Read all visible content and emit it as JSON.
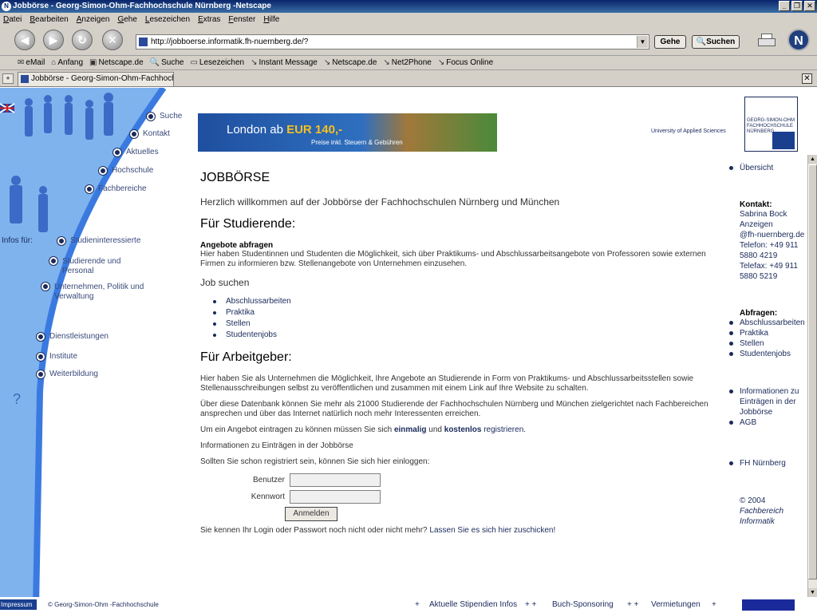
{
  "window": {
    "title": "Jobbörse - Georg-Simon-Ohm-Fachhochschule Nürnberg -Netscape",
    "minimize": "_",
    "maximize": "❐",
    "close": "✕"
  },
  "menu": [
    "Datei",
    "Bearbeiten",
    "Anzeigen",
    "Gehe",
    "Lesezeichen",
    "Extras",
    "Fenster",
    "Hilfe"
  ],
  "nav": {
    "url": "http://jobboerse.informatik.fh-nuernberg.de/?",
    "go_label": "Gehe",
    "search_label": "Suchen",
    "logo_letter": "N"
  },
  "personal_toolbar": {
    "items": [
      {
        "label": "eMail"
      },
      {
        "label": "Anfang"
      },
      {
        "label": "Netscape.de"
      },
      {
        "label": "Suche"
      },
      {
        "label": "Lesezeichen"
      },
      {
        "label": "Instant Message"
      },
      {
        "label": "Netscape.de"
      },
      {
        "label": "Net2Phone"
      },
      {
        "label": "Focus Online"
      }
    ]
  },
  "tab": {
    "title": "Jobbörse - Georg-Simon-Ohm-Fachhochsch..."
  },
  "leftnav": {
    "top_items": [
      "Suche",
      "Kontakt",
      "Aktuelles",
      "Hochschule",
      "Fachbereiche"
    ],
    "infos_label": "Infos für:",
    "info_items": [
      "Studieninteressierte",
      "Studierende und Personal",
      "Unternehmen, Politik und Verwaltung"
    ],
    "bottom_items": [
      "Dienstleistungen",
      "Institute",
      "Weiterbildung"
    ],
    "help": "?"
  },
  "header": {
    "banner_text_prefix": "London ab ",
    "banner_price": "EUR 140,-",
    "banner_subtext": "Preise inkl. Steuern & Gebühren",
    "university_label": "University of Applied Sciences",
    "logo_text": "GEORG-SIMON-OHM FACHHOCHSCHULE NÜRNBERG"
  },
  "main": {
    "title": "JOBBÖRSE",
    "welcome": "Herzlich willkommen auf der Jobbörse der Fachhochschulen Nürnberg und München",
    "students_heading": "Für Studierende:",
    "angebote_heading": "Angebote abfragen",
    "angebote_text": "Hier haben Studentinnen und Studenten die Möglichkeit, sich über Praktikums- und Abschlussarbeitsangebote von Professoren sowie externen Firmen zu informieren bzw. Stellenangebote von Unternehmen einzusehen.",
    "job_suchen": "Job suchen",
    "job_links": [
      "Abschlussarbeiten",
      "Praktika",
      "Stellen",
      "Studentenjobs"
    ],
    "employer_heading": "Für Arbeitgeber:",
    "employer_text1": "Hier haben Sie als Unternehmen die Möglichkeit, Ihre Angebote an Studierende in Form von Praktikums- und Abschlussarbeitsstellen sowie Stellenausschreibungen selbst zu veröffentlichen und zusammen mit einem Link auf Ihre Website zu schalten.",
    "employer_text2": "Über diese Datenbank können Sie mehr als 21000 Studierende der Fachhochschulen Nürnberg und München zielgerichtet nach Fachbereichen ansprechen und über das Internet natürlich noch mehr Interessenten erreichen.",
    "register_prefix": "Um ein Angebot eintragen zu können müssen Sie sich ",
    "register_em1": "einmalig",
    "register_mid": " und ",
    "register_em2": "kostenlos",
    "register_suffix": " registrieren.",
    "info_link": "Informationen zu Einträgen in der Jobbörse",
    "login_prompt": "Sollten Sie schon registriert sein, können Sie sich hier einloggen:",
    "user_label": "Benutzer",
    "password_label": "Kennwort",
    "login_button": "Anmelden",
    "forgot_prefix": "Sie kennen Ihr Login oder Passwort noch nicht oder nicht mehr? ",
    "forgot_link": "Lassen Sie es sich hier zuschicken!"
  },
  "right": {
    "overview": "Übersicht",
    "contact_heading": "Kontakt:",
    "contact_lines": [
      "Sabrina Bock",
      "Anzeigen",
      "@fh-nuernberg.de",
      "Telefon: +49 911",
      "5880 4219",
      "Telefax: +49 911",
      "5880 5219"
    ],
    "queries_heading": "Abfragen:",
    "queries": [
      "Abschlussarbeiten",
      "Praktika",
      "Stellen",
      "Studentenjobs"
    ],
    "info_link": "Informationen zu Einträgen in der Jobbörse",
    "agb": "AGB",
    "fh_link": "FH Nürnberg",
    "copyright": [
      "© 2004",
      "Fachbereich",
      "Informatik"
    ]
  },
  "footer": {
    "impressum": "Impressum",
    "copy": "© Georg-Simon-Ohm -Fachhochschule",
    "links": [
      "Aktuelle Stipendien Infos",
      "Buch-Sponsoring",
      "Vermietungen"
    ]
  },
  "colors": {
    "accent": "#1a2a5a",
    "curve": "#3a7ae0",
    "left_bg": "#7fb3ee"
  }
}
